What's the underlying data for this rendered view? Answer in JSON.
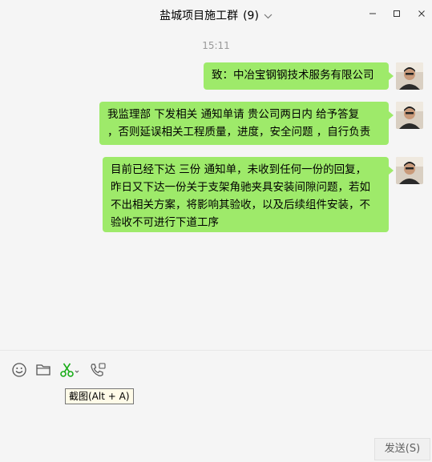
{
  "window": {
    "group_name": "盐城项目施工群",
    "member_count": "(9)"
  },
  "chat": {
    "timestamp": "15:11",
    "messages": [
      {
        "text": "致：中冶宝钢钢技术服务有限公司"
      },
      {
        "text": "我监理部 下发相关 通知单请 贵公司两日内 给予答复\n，否则延误相关工程质量，进度，安全问题 ，自行负责"
      },
      {
        "text": "目前已经下达 三份 通知单，未收到任何一份的回复，\n昨日又下达一份关于支架角驰夹具安装间隙问题，若如\n不出相关方案，将影响其验收，以及后续组件安装，不\n验收不可进行下道工序"
      }
    ]
  },
  "toolbar": {
    "icons": [
      "emoji-icon",
      "folder-icon",
      "scissors-icon",
      "call-icon"
    ],
    "screenshot_tooltip": "截图(Alt + A)"
  },
  "composer": {
    "send_label": "发送(S)"
  },
  "colors": {
    "bubble": "#9eea6a",
    "background": "#f5f5f5",
    "accent": "#1aad19"
  }
}
